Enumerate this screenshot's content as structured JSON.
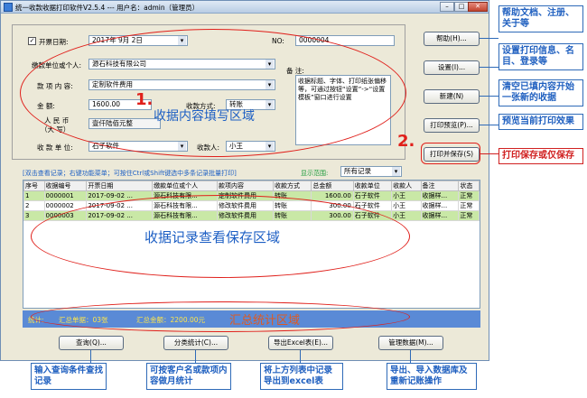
{
  "window": {
    "title": "统一收款收据打印软件V2.5.4 --- 用户名：admin（管理员）"
  },
  "form": {
    "date_label": "开票日期:",
    "date_value": "2017年 9月 2日",
    "no_label": "NO:",
    "no_value": "0000004",
    "payer_label": "缴款单位或个人:",
    "payer_value": "源石科技有限公司",
    "item_label": "款 项 内 容:",
    "item_value": "定制软件费用",
    "amount_label": "金      额:",
    "amount_value": "1600.00",
    "paytype_label": "收款方式:",
    "paytype_value": "转账",
    "rmb_label_1": "人  民  币",
    "rmb_label_2": "（大  写）",
    "rmb_value": "壹仟陆佰元整",
    "payee_unit_label": "收 款 单 位:",
    "payee_unit_value": "石子软件",
    "payee_label": "收款人:",
    "payee_value": "小王",
    "remark_label": "备 注:",
    "remark_value": "收据标题、字体、打印纸张偏移等，可通过按钮“设置”->“设置模板”窗口进行设置"
  },
  "buttons": {
    "help": "帮助(H)...",
    "settings": "设置(I)...",
    "new": "新建(N)",
    "preview": "打印预览(P)...",
    "print_save": "打印并保存(S)",
    "query": "查询(Q)...",
    "stats": "分类统计(C)...",
    "export": "导出Excel表(E)...",
    "manage": "管理数据(M)..."
  },
  "hint": "[双击查看记录；右键功能菜单；可按住Ctrl或Shift键选中多条记录批量打印]",
  "range": {
    "label": "显示范围:",
    "value": "所有记录"
  },
  "table": {
    "headers": [
      "序号",
      "收据编号",
      "开票日期",
      "缴款单位或个人",
      "款项内容",
      "收款方式",
      "总金额",
      "收款单位",
      "收款人",
      "备注",
      "状态"
    ],
    "rows": [
      [
        "1",
        "0000001",
        "2017-09-02 ...",
        "源石科技有限...",
        "定制软件费用",
        "转账",
        "1600.00",
        "石子软件",
        "小王",
        "收据样...",
        "正常"
      ],
      [
        "2",
        "0000002",
        "2017-09-02 ...",
        "源石科技有限...",
        "修改软件费用",
        "转账",
        "300.00",
        "石子软件",
        "小王",
        "收据样...",
        "正常"
      ],
      [
        "3",
        "0000003",
        "2017-09-02 ...",
        "源石科技有限...",
        "修改软件费用",
        "转账",
        "300.00",
        "石子软件",
        "小王",
        "收据样...",
        "正常"
      ]
    ]
  },
  "stats": {
    "label": "统计:",
    "count_text": "汇总单据：03张",
    "total_text": "汇总金额：2200.00元"
  },
  "annotations": {
    "n1": "1.",
    "n2": "2.",
    "area_form": "收据内容填写区域",
    "area_table": "收据记录查看保存区域",
    "area_stats": "汇总统计区域",
    "c_help": "帮助文档、注册、关于等",
    "c_settings": "设置打印信息、名目、登录等",
    "c_new": "清空已填内容开始一张新的收据",
    "c_preview": "预览当前打印效果",
    "c_print": "打印保存或仅保存",
    "c_query": "输入查询条件查找记录",
    "c_stats": "可按客户名或款项内容做月统计",
    "c_export": "将上方列表中记录导出到excel表",
    "c_manage": "导出、导入数据库及重新记账操作"
  }
}
